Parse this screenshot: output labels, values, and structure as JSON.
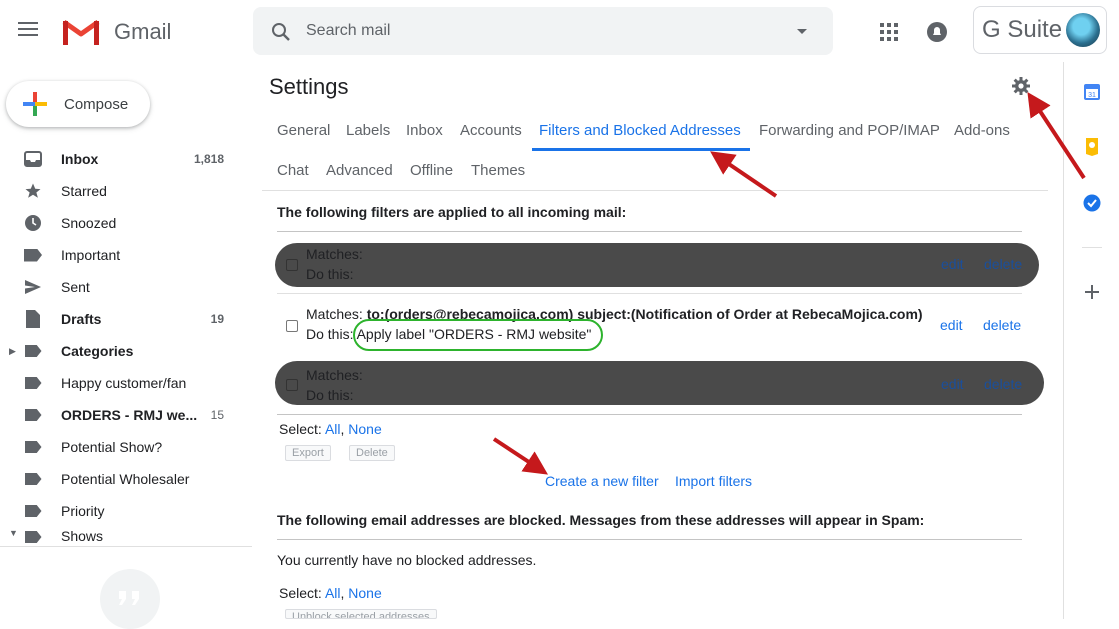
{
  "app": {
    "name": "Gmail",
    "brand": "G Suite"
  },
  "search": {
    "placeholder": "Search mail"
  },
  "compose": {
    "label": "Compose"
  },
  "sidebar": {
    "items": [
      {
        "label": "Inbox",
        "count": "1,818",
        "icon": "inbox-icon",
        "bold": true
      },
      {
        "label": "Starred",
        "count": "",
        "icon": "star-icon"
      },
      {
        "label": "Snoozed",
        "count": "",
        "icon": "clock-icon"
      },
      {
        "label": "Important",
        "count": "",
        "icon": "important-icon"
      },
      {
        "label": "Sent",
        "count": "",
        "icon": "send-icon"
      },
      {
        "label": "Drafts",
        "count": "19",
        "icon": "draft-icon",
        "bold": true
      },
      {
        "label": "Categories",
        "count": "",
        "icon": "label-icon",
        "bold": true
      },
      {
        "label": "Happy customer/fan",
        "count": "",
        "icon": "label-icon"
      },
      {
        "label": "ORDERS - RMJ we...",
        "count": "15",
        "icon": "label-icon",
        "bold": true
      },
      {
        "label": "Potential Show?",
        "count": "",
        "icon": "label-icon"
      },
      {
        "label": "Potential Wholesaler",
        "count": "",
        "icon": "label-icon"
      },
      {
        "label": "Priority",
        "count": "",
        "icon": "label-icon"
      },
      {
        "label": "Shows",
        "count": "",
        "icon": "label-icon"
      }
    ]
  },
  "settings": {
    "title": "Settings",
    "tabs_row1": [
      "General",
      "Labels",
      "Inbox",
      "Accounts",
      "Filters and Blocked Addresses",
      "Forwarding and POP/IMAP",
      "Add-ons"
    ],
    "tabs_row2": [
      "Chat",
      "Advanced",
      "Offline",
      "Themes"
    ],
    "filters_heading": "The following filters are applied to all incoming mail:",
    "filters": [
      {
        "matches": "Matches:",
        "do_this": "Do this:"
      },
      {
        "matches_prefix": "Matches: ",
        "matches_value": "to:(orders@rebecamojica.com) subject:(Notification of Order at RebecaMojica.com)",
        "do_this_prefix": "Do this: ",
        "do_this_value": "Apply label \"ORDERS - RMJ website\""
      },
      {
        "matches": "Matches:",
        "do_this": "Do this:"
      }
    ],
    "edit_label": "edit",
    "delete_label": "delete",
    "select_label": "Select:",
    "select_all": "All",
    "select_none": "None",
    "export_label": "Export",
    "delete_btn_label": "Delete",
    "create_filter": "Create a new filter",
    "import_filters": "Import filters",
    "blocked_heading": "The following email addresses are blocked. Messages from these addresses will appear in Spam:",
    "no_blocked": "You currently have no blocked addresses.",
    "unblock_label": "Unblock selected addresses"
  },
  "colors": {
    "accent": "#1a73e8",
    "gmail_red": "#ea4335",
    "annotation_red": "#c5191c",
    "annotation_green": "#2db32d"
  }
}
